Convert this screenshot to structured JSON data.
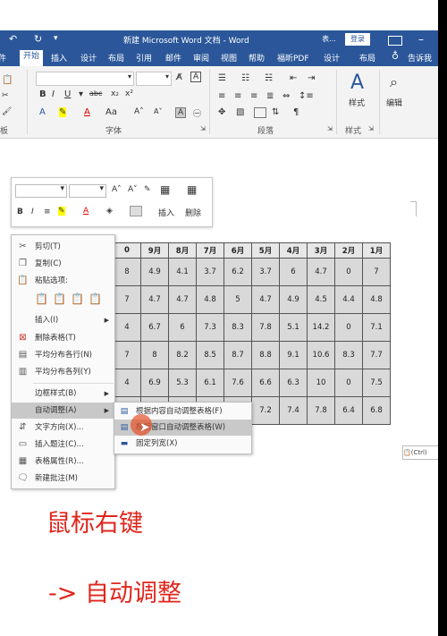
{
  "titlebar": {
    "undo_icon": "undo-icon",
    "redo_icon": "redo-icon",
    "title": "新建 Microsoft Word 文档 - Word",
    "login": "登录",
    "mode_label": "表..."
  },
  "tabs": [
    "开始",
    "插入",
    "设计",
    "布局",
    "引用",
    "邮件",
    "审阅",
    "视图",
    "帮助",
    "福昕PDF",
    "设计",
    "布局"
  ],
  "tell_me": "告诉我",
  "ribbon": {
    "groups": {
      "font": "字体",
      "paragraph": "段落",
      "styles": "样式",
      "editing": "编辑"
    },
    "styles_label": "样式",
    "editing_label": "编辑",
    "clipboard_label": "板",
    "font_name": "",
    "font_size": ""
  },
  "mini_toolbar": {
    "insert": "插入",
    "delete": "删除"
  },
  "table": {
    "header": [
      "0",
      "9月",
      "8月",
      "7月",
      "6月",
      "5月",
      "4月",
      "3月",
      "2月",
      "1月"
    ],
    "rows": [
      [
        "8",
        "4.9",
        "4.1",
        "3.7",
        "6.2",
        "3.7",
        "6",
        "4.7",
        "0",
        "7"
      ],
      [
        "7",
        "4.7",
        "4.7",
        "4.8",
        "5",
        "4.7",
        "4.9",
        "4.5",
        "4.4",
        "4.8"
      ],
      [
        "4",
        "6.7",
        "6",
        "7.3",
        "8.3",
        "7.8",
        "5.1",
        "14.2",
        "0",
        "7.1"
      ],
      [
        "7",
        "8",
        "8.2",
        "8.5",
        "8.7",
        "8.8",
        "9.1",
        "10.6",
        "8.3",
        "7.7"
      ],
      [
        "4",
        "6.9",
        "5.3",
        "6.1",
        "7.6",
        "6.6",
        "6.3",
        "10",
        "0",
        "7.5"
      ],
      [
        "",
        "",
        "",
        "",
        "",
        "7.2",
        "7.4",
        "7.8",
        "6.4",
        "6.8"
      ]
    ]
  },
  "context_menu": {
    "items": [
      {
        "label": "剪切(T)",
        "icon": "scissors-icon"
      },
      {
        "label": "复制(C)",
        "icon": "copy-icon"
      },
      {
        "label": "粘贴选项:",
        "icon": "paste-icon"
      },
      {
        "label": "插入(I)",
        "icon": "",
        "arrow": true
      },
      {
        "label": "删除表格(T)",
        "icon": "delete-table-icon"
      },
      {
        "label": "平均分布各行(N)",
        "icon": "distribute-rows-icon"
      },
      {
        "label": "平均分布各列(Y)",
        "icon": "distribute-columns-icon"
      },
      {
        "label": "边框样式(B)",
        "icon": "",
        "arrow": true
      },
      {
        "label": "自动调整(A)",
        "icon": "",
        "arrow": true
      },
      {
        "label": "文字方向(X)...",
        "icon": "text-direction-icon"
      },
      {
        "label": "插入题注(C)...",
        "icon": "caption-icon"
      },
      {
        "label": "表格属性(R)...",
        "icon": "table-properties-icon"
      },
      {
        "label": "新建批注(M)",
        "icon": "comment-icon"
      }
    ]
  },
  "submenu": {
    "items": [
      {
        "label": "根据内容自动调整表格(F)"
      },
      {
        "label": "根据窗口自动调整表格(W)"
      },
      {
        "label": "固定列宽(X)"
      }
    ]
  },
  "paste_ctrl": "(Ctrl)",
  "captions": {
    "line1": "鼠标右键",
    "line2": "-> 自动调整"
  }
}
